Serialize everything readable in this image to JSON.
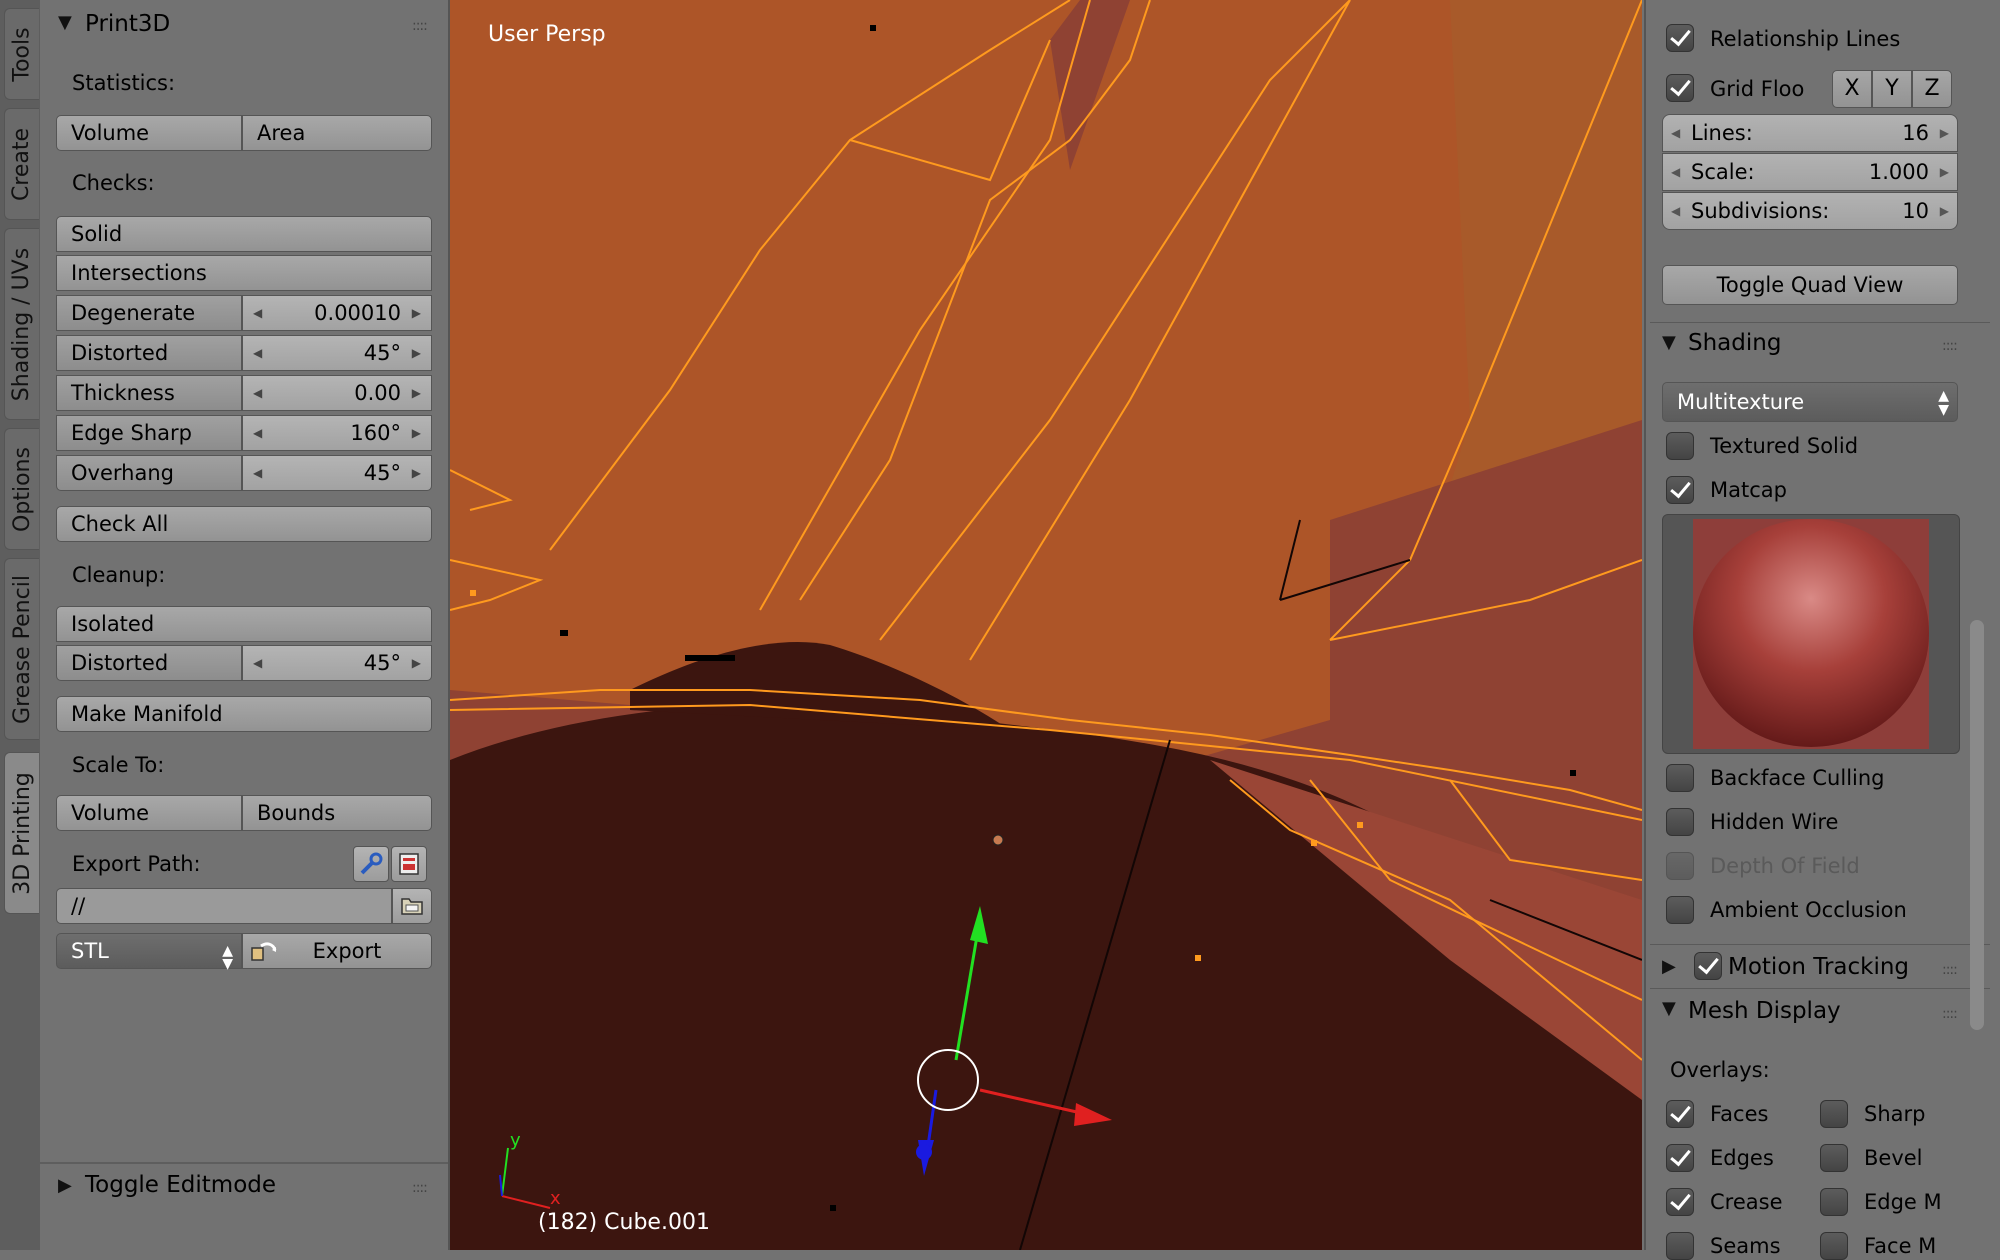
{
  "tabs": [
    "Tools",
    "Create",
    "Shading / UVs",
    "Options",
    "Grease Pencil",
    "3D Printing"
  ],
  "active_tab": "3D Printing",
  "print3d": {
    "title": "Print3D",
    "statistics_label": "Statistics:",
    "volume_btn": "Volume",
    "area_btn": "Area",
    "checks_label": "Checks:",
    "solid_btn": "Solid",
    "intersections_btn": "Intersections",
    "degenerate_label": "Degenerate",
    "degenerate_value": "0.00010",
    "distorted_label": "Distorted",
    "distorted_value": "45°",
    "thickness_label": "Thickness",
    "thickness_value": "0.00",
    "edge_sharp_label": "Edge Sharp",
    "edge_sharp_value": "160°",
    "overhang_label": "Overhang",
    "overhang_value": "45°",
    "check_all_btn": "Check All",
    "cleanup_label": "Cleanup:",
    "isolated_btn": "Isolated",
    "cleanup_distorted_label": "Distorted",
    "cleanup_distorted_value": "45°",
    "make_manifold_btn": "Make Manifold",
    "scale_to_label": "Scale To:",
    "scale_volume_btn": "Volume",
    "scale_bounds_btn": "Bounds",
    "export_path_label": "Export Path:",
    "export_path_value": "//",
    "format_value": "STL",
    "export_btn": "Export"
  },
  "toggle_editmode": "Toggle Editmode",
  "viewport": {
    "view_label": "User Persp",
    "object_label": "(182) Cube.001",
    "axis_x": "x",
    "axis_y": "y"
  },
  "right": {
    "relationship_lines": "Relationship Lines",
    "grid_floor": "Grid Floo",
    "x": "X",
    "y": "Y",
    "z": "Z",
    "lines_label": "Lines:",
    "lines_value": "16",
    "scale_label": "Scale:",
    "scale_value": "1.000",
    "subdiv_label": "Subdivisions:",
    "subdiv_value": "10",
    "toggle_quad": "Toggle Quad View",
    "shading_title": "Shading",
    "shading_mode": "Multitexture",
    "textured_solid": "Textured Solid",
    "matcap": "Matcap",
    "backface_culling": "Backface Culling",
    "hidden_wire": "Hidden Wire",
    "depth_of_field": "Depth Of Field",
    "ambient_occlusion": "Ambient Occlusion",
    "motion_tracking": "Motion Tracking",
    "mesh_display": "Mesh Display",
    "overlays_label": "Overlays:",
    "faces": "Faces",
    "sharp": "Sharp",
    "edges": "Edges",
    "bevel": "Bevel",
    "crease": "Crease",
    "edge_m": "Edge M",
    "seams": "Seams",
    "face_m": "Face M"
  },
  "colors": {
    "panel_bg": "#727272",
    "viewport_face": "#ad5528",
    "viewport_dark": "#3c150f",
    "wire": "#ff9a1e",
    "matcap": "#9a2e2a"
  }
}
